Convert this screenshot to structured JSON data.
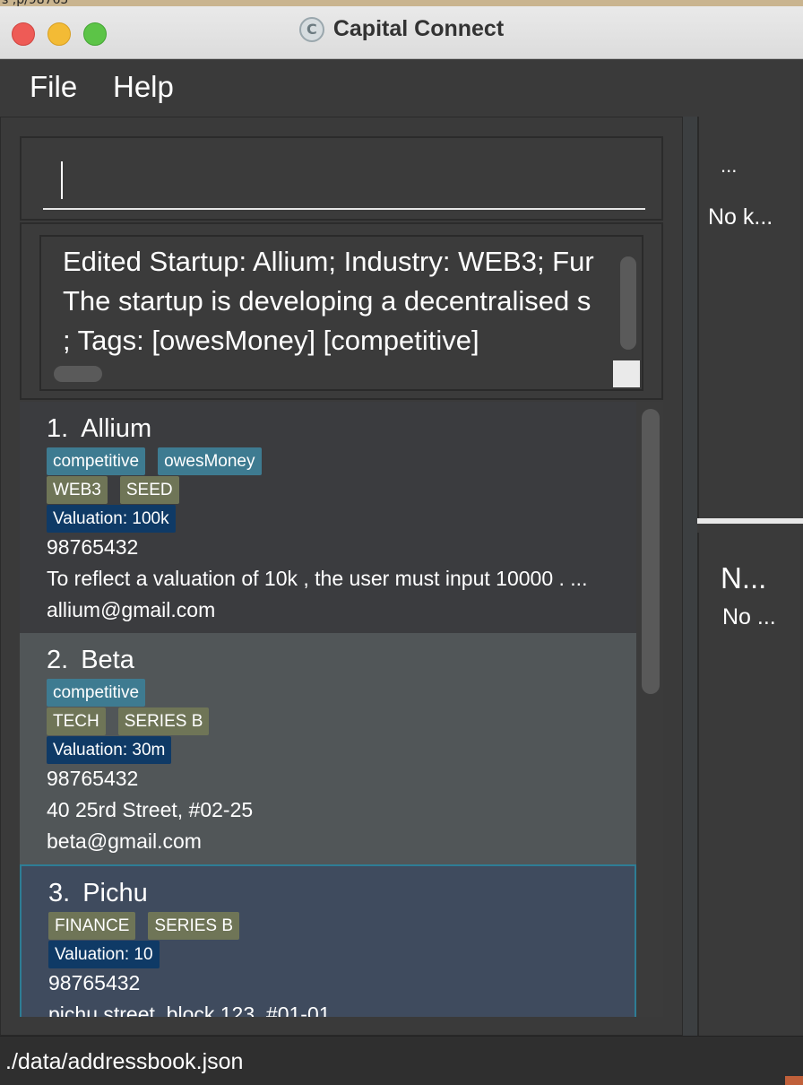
{
  "window": {
    "title": "Capital Connect",
    "background_hint_text": "s ,p/98765"
  },
  "menu": {
    "file": "File",
    "help": "Help"
  },
  "command": {
    "value": ""
  },
  "result": {
    "text": "Edited Startup: Allium; Industry: WEB3; Fur\nThe startup is developing a decentralised s\n; Tags: [owesMoney] [competitive]"
  },
  "startups": [
    {
      "index": "1.",
      "name": "Allium",
      "tags": [
        "competitive",
        "owesMoney"
      ],
      "industry": "WEB3",
      "funding": "SEED",
      "valuation": "Valuation: 100k",
      "phone": "98765432",
      "address": "To reflect a valuation of 10k , the user must input 10000 . ...",
      "email": "allium@gmail.com"
    },
    {
      "index": "2.",
      "name": "Beta",
      "tags": [
        "competitive"
      ],
      "industry": "TECH",
      "funding": "SERIES B",
      "valuation": "Valuation: 30m",
      "phone": "98765432",
      "address": "40 25rd Street, #02-25",
      "email": "beta@gmail.com"
    },
    {
      "index": "3.",
      "name": "Pichu",
      "tags": [],
      "industry": "FINANCE",
      "funding": "SERIES B",
      "valuation": "Valuation: 10",
      "phone": "98765432",
      "address": "pichu street, block 123, #01-01",
      "email": ""
    }
  ],
  "side_panel": {
    "top_dots": "...",
    "top_text": "No k...",
    "bottom_title": "N...",
    "bottom_text": "No ..."
  },
  "status": {
    "path": "./data/addressbook.json"
  },
  "colors": {
    "tag_blue": "#3e7b91",
    "tag_olive": "#6f7557",
    "tag_navy": "#0f3a66",
    "selected_border": "#2e7d95"
  }
}
